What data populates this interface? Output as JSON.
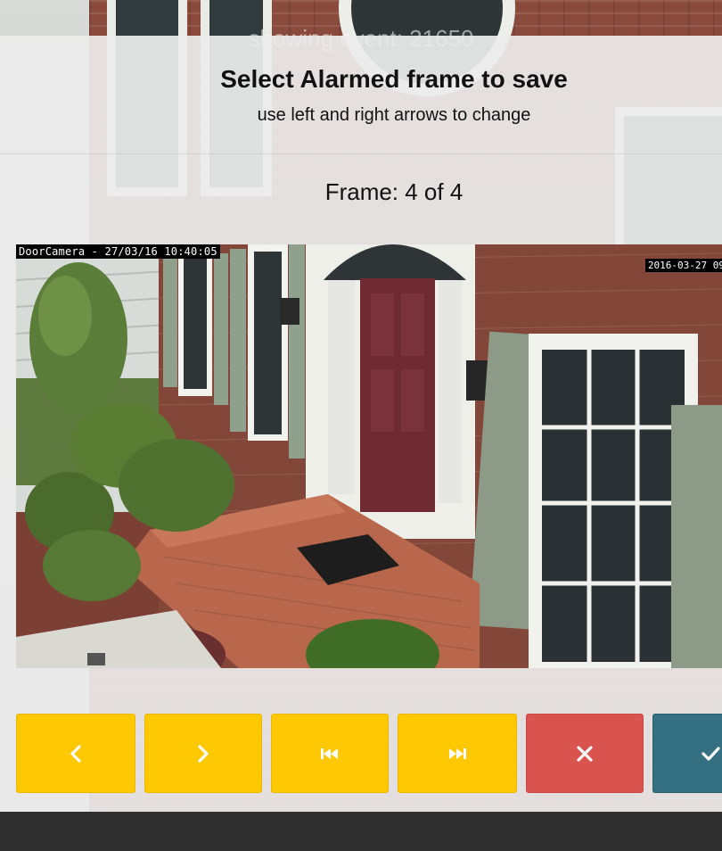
{
  "background": {
    "title": "showing event: 21650"
  },
  "modal": {
    "title": "Select Alarmed frame to save",
    "subtitle": "use left and right arrows to change",
    "frame_counter": "Frame: 4 of 4"
  },
  "camera": {
    "osd_left": "DoorCamera - 27/03/16 10:40:05",
    "osd_right": "2016-03-27 09"
  },
  "buttons": [
    {
      "name": "previous-frame-button",
      "icon": "chevron-left-icon",
      "color": "#fec803"
    },
    {
      "name": "next-frame-button",
      "icon": "chevron-right-icon",
      "color": "#fec803"
    },
    {
      "name": "first-frame-button",
      "icon": "skip-back-icon",
      "color": "#fec803"
    },
    {
      "name": "last-frame-button",
      "icon": "skip-forward-icon",
      "color": "#fec803"
    },
    {
      "name": "cancel-button",
      "icon": "close-icon",
      "color": "#d9534f"
    },
    {
      "name": "save-button",
      "icon": "check-icon",
      "color": "#347082"
    }
  ],
  "colors": {
    "accent_yellow": "#fec803",
    "danger_red": "#d9534f",
    "confirm_teal": "#347082",
    "bottom_bar": "#2f2f2f"
  }
}
